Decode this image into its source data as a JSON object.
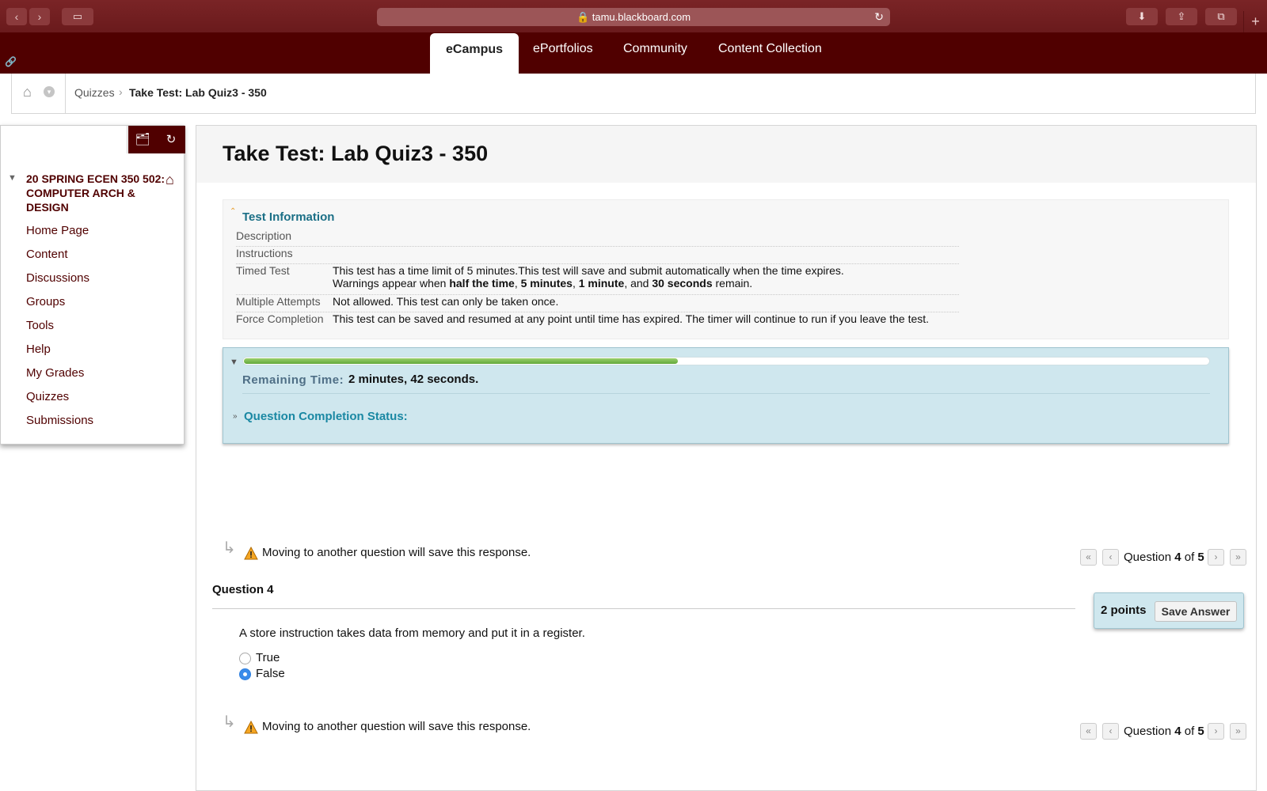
{
  "browser": {
    "url": "tamu.blackboard.com",
    "back_icon": "‹",
    "forward_icon": "›",
    "sidebar_icon": "▭",
    "download_icon": "⬇",
    "share_icon": "⇪",
    "tabs_icon": "⧉",
    "reload_icon": "↻",
    "new_tab_icon": "+"
  },
  "site_tabs": [
    "eCampus",
    "ePortfolios",
    "Community",
    "Content Collection"
  ],
  "breadcrumb": {
    "parent": "Quizzes",
    "separator": "›",
    "current": "Take Test: Lab Quiz3 - 350"
  },
  "sidebar": {
    "course_title": "20 SPRING ECEN 350 502: COMPUTER ARCH & DESIGN",
    "items": [
      "Home Page",
      "Content",
      "Discussions",
      "Groups",
      "Tools",
      "Help",
      "My Grades",
      "Quizzes",
      "Submissions"
    ]
  },
  "page_title": "Take Test: Lab Quiz3 - 350",
  "test_information": {
    "heading": "Test Information",
    "description_label": "Description",
    "instructions_label": "Instructions",
    "timed_label": "Timed Test",
    "timed_line1": "This test has a time limit of 5 minutes.This test will save and submit automatically when the time expires.",
    "timed_line2_pre": "Warnings appear when ",
    "warn1": "half the time",
    "sep1": ", ",
    "warn2": "5 minutes",
    "sep2": ", ",
    "warn3": "1 minute",
    "sep3": ", and ",
    "warn4": "30 seconds",
    "timed_line2_post": " remain.",
    "attempts_label": "Multiple Attempts",
    "attempts_value": "Not allowed. This test can only be taken once.",
    "force_label": "Force Completion",
    "force_value": "This test can be saved and resumed at any point until time has expired. The timer will continue to run if you leave the test."
  },
  "timer": {
    "remaining_label": "Remaining Time:",
    "remaining_minutes": "2",
    "minutes_word": " minutes, ",
    "remaining_seconds": "42",
    "seconds_word": " seconds.",
    "progress_fraction": 0.45,
    "completion_label": "Question Completion Status:"
  },
  "save_notice": "Moving to another question will save this response.",
  "pager": {
    "prefix": "Question ",
    "current": "4",
    "of": " of ",
    "total": "5"
  },
  "question": {
    "heading": "Question 4",
    "points": "2 points",
    "save_button": "Save Answer",
    "text": "A store instruction takes data from memory and put it in a register.",
    "options": [
      {
        "label": "True",
        "selected": false
      },
      {
        "label": "False",
        "selected": true
      }
    ]
  },
  "colors": {
    "maroon": "#500000",
    "timer_bg": "#cfe7ee",
    "link_teal": "#1b6f86",
    "progress_green": "#62a83a"
  }
}
